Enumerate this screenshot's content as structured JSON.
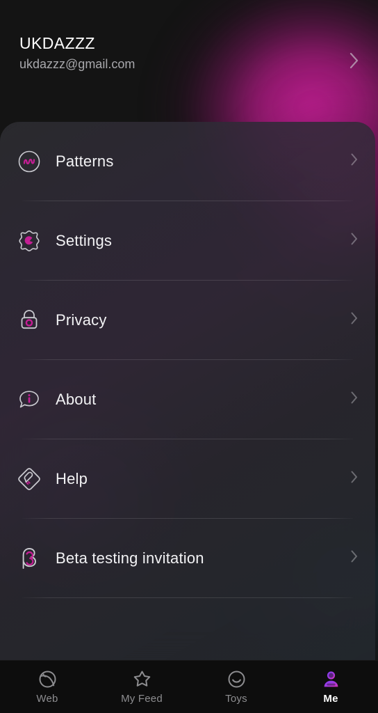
{
  "app": {
    "theme": {
      "background": "#141414",
      "card": "#2e2c34",
      "accent_magenta": "#c41e94",
      "accent_purple": "#8b3df0",
      "text_primary": "#f2f2f4",
      "text_secondary": "#a8a8ac",
      "nav_background": "#0d0d0d"
    }
  },
  "account": {
    "name": "UKDAZZZ",
    "email": "ukdazzz@gmail.com",
    "chevron_icon": "chevron-right-icon"
  },
  "menu": {
    "items": [
      {
        "label": "Patterns",
        "icon": "patterns-wave-icon",
        "chevron_icon": "chevron-right-icon"
      },
      {
        "label": "Settings",
        "icon": "gear-icon",
        "chevron_icon": "chevron-right-icon"
      },
      {
        "label": "Privacy",
        "icon": "lock-icon",
        "chevron_icon": "chevron-right-icon"
      },
      {
        "label": "About",
        "icon": "info-bubble-icon",
        "chevron_icon": "chevron-right-icon"
      },
      {
        "label": "Help",
        "icon": "diamond-help-icon",
        "chevron_icon": "chevron-right-icon"
      },
      {
        "label": "Beta testing invitation",
        "icon": "beta-icon",
        "chevron_icon": "chevron-right-icon"
      }
    ]
  },
  "bottom_nav": {
    "items": [
      {
        "label": "Web",
        "icon": "globe-icon",
        "active": false
      },
      {
        "label": "My Feed",
        "icon": "star-icon",
        "active": false
      },
      {
        "label": "Toys",
        "icon": "smiley-icon",
        "active": false
      },
      {
        "label": "Me",
        "icon": "person-icon",
        "active": true
      }
    ]
  }
}
